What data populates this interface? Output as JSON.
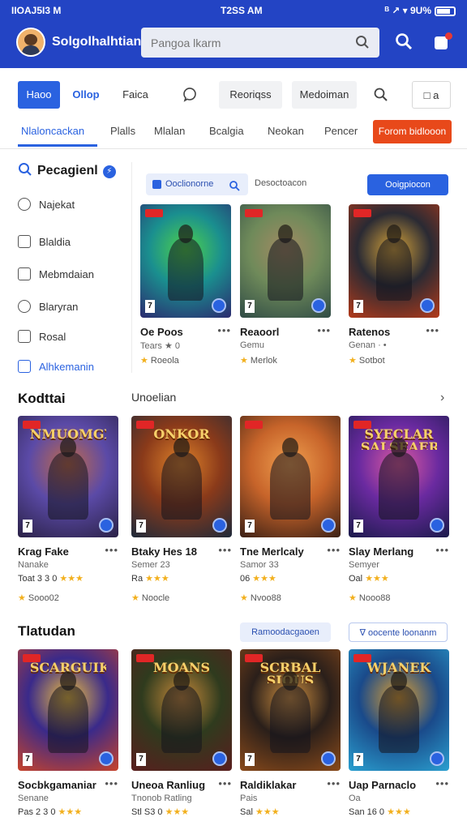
{
  "status_bar": {
    "carrier": "IIOAJ5I3 M",
    "time": "T2SS AM",
    "right": "ᴮ ↗ ▾ 9U%"
  },
  "header": {
    "app_name": "Solgolhalhtian",
    "search_placeholder": "Pangoa lkarm",
    "accent": "#2344c4"
  },
  "toolbar": {
    "primary": "Haoo",
    "link": "Ollop",
    "plain": "Faica",
    "soft1": "Reoriqss",
    "soft2": "Medoiman",
    "outline": "□ a"
  },
  "tabs": {
    "items": [
      "Nlaloncackan",
      "Plalls",
      "Mlalan",
      "Bcalgia",
      "Neokan",
      "Pencer"
    ],
    "active_index": 0,
    "cta": "Forom bidlooon",
    "cta_color": "#e8491a"
  },
  "sidebar": {
    "title": "Pecagienl",
    "items": [
      {
        "label": "Najekat",
        "icon": "clock-icon"
      },
      {
        "label": "Blaldia",
        "icon": "square-icon"
      },
      {
        "label": "Mebmdaian",
        "icon": "grid-icon"
      },
      {
        "label": "Blaryran",
        "icon": "chat-icon"
      },
      {
        "label": "Rosal",
        "icon": "shield-icon"
      },
      {
        "label": "Alhkemanin",
        "icon": "book-icon",
        "active": true
      }
    ]
  },
  "featured": {
    "chip": "Ooclionorne",
    "text": "Desoctoacon",
    "button": "Ooigpiocon",
    "cards": [
      {
        "title": "Oe Poos",
        "sub": "Tears ★ 0",
        "foot": "Roeola",
        "colors": [
          "#1a8f8f",
          "#2b2a6f",
          "#4fd24a"
        ]
      },
      {
        "title": "Reaoorl",
        "sub": "Gemu",
        "foot": "Merlok",
        "colors": [
          "#6f8a5a",
          "#2f4b45",
          "#a48a63"
        ]
      },
      {
        "title": "Ratenos",
        "sub": "Genan · •",
        "foot": "Sotbot",
        "colors": [
          "#2a2a33",
          "#b33a1a",
          "#d7a43a"
        ]
      }
    ]
  },
  "section1": {
    "title": "Kodttai",
    "subtitle": "Unoelian",
    "chevron": "›",
    "cards": [
      {
        "title": "Krag Fake",
        "sub": "Nanake",
        "meta": "Toat 3 3 0",
        "foot": "Sooo02",
        "banner": "NMUOMGX",
        "colors": [
          "#5b4aa7",
          "#2a2146",
          "#c26a48"
        ]
      },
      {
        "title": "Btaky Hes 18",
        "sub": "Semer 23",
        "meta": "Ra",
        "foot": "Noocle",
        "banner": "ONKOR",
        "colors": [
          "#8a3a1a",
          "#1e2a3a",
          "#e0832a"
        ]
      },
      {
        "title": "Tne Merlcaly",
        "sub": "Samor 33",
        "meta": "06",
        "foot": "Nvoo88",
        "banner": "",
        "colors": [
          "#c7642a",
          "#3a2015",
          "#f0a050"
        ]
      },
      {
        "title": "Slay Merlang",
        "sub": "Semyer",
        "meta": "Oal",
        "foot": "Nooo88",
        "banner": "SYECLAR SALSEAER",
        "colors": [
          "#6a2aa0",
          "#1a1a4a",
          "#e05aa0"
        ]
      }
    ]
  },
  "section2": {
    "title": "Tlatudan",
    "pill1": "Ramoodacgaoen",
    "pill2": "∇ oocente loonanm",
    "cards": [
      {
        "title": "Socbkgamaniar",
        "sub": "Senane",
        "meta": "Pas 2 3 0",
        "banner": "SCARGUIK",
        "colors": [
          "#3a2a8a",
          "#c8432a",
          "#f0c040"
        ]
      },
      {
        "title": "Uneoa Ranliug",
        "sub": "Tnonob Ratling",
        "meta": "Stl S3 0",
        "banner": "MOANS",
        "colors": [
          "#2f3b1e",
          "#5a1e1e",
          "#c88a3a"
        ]
      },
      {
        "title": "Raldiklakar",
        "sub": "Pais",
        "meta": "Sal",
        "banner": "SCRBAL SIOUS",
        "colors": [
          "#2a1f1a",
          "#8a4a1a",
          "#d09040"
        ]
      },
      {
        "title": "Uap Parnaclo",
        "sub": "Oa",
        "meta": "San 16 0",
        "banner": "WJANEK",
        "colors": [
          "#1a4a8a",
          "#2aa0d0",
          "#e0a030"
        ]
      }
    ]
  }
}
